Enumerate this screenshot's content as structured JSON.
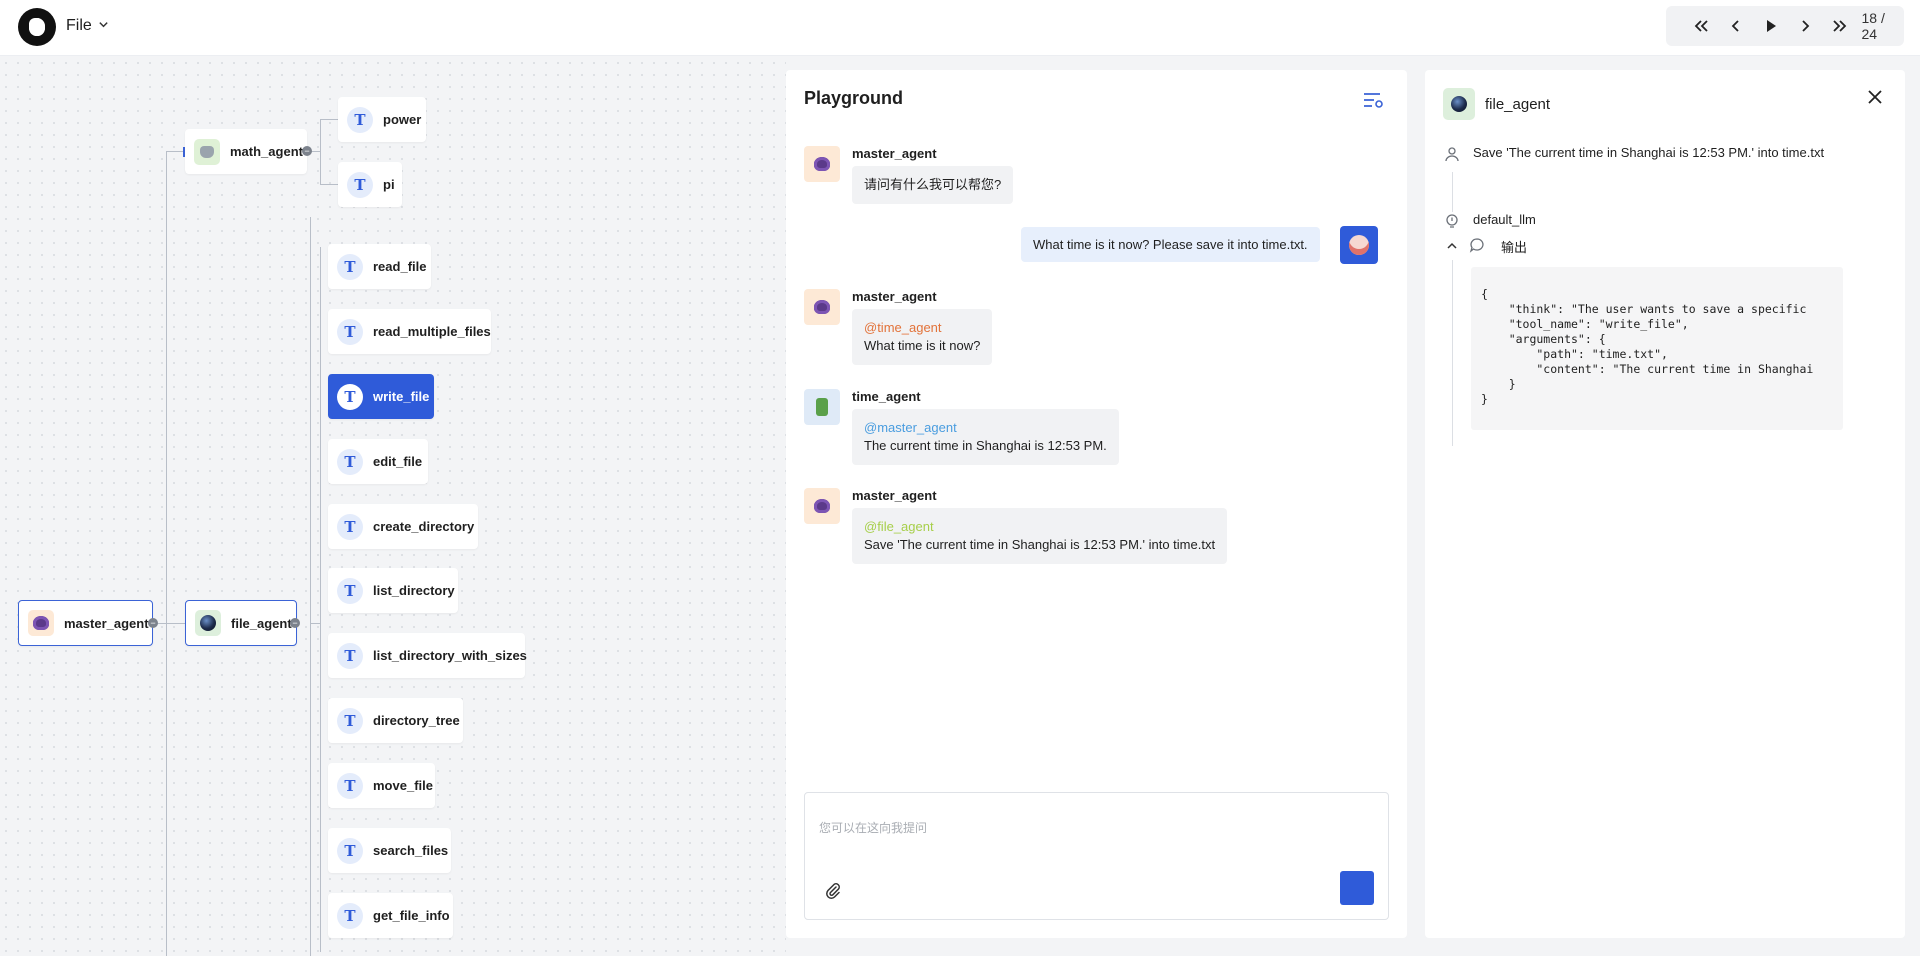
{
  "topbar": {
    "file_menu_label": "File",
    "player": {
      "current": "18",
      "total": "24",
      "counter_text": "18 / 24"
    }
  },
  "tree": {
    "root": {
      "label": "master_agent"
    },
    "agents": [
      {
        "label": "math_agent",
        "tools": [
          "power",
          "pi"
        ]
      },
      {
        "label": "file_agent",
        "tools": [
          "read_file",
          "read_multiple_files",
          "write_file",
          "edit_file",
          "create_directory",
          "list_directory",
          "list_directory_with_sizes",
          "directory_tree",
          "move_file",
          "search_files",
          "get_file_info"
        ]
      }
    ],
    "active_tool": "write_file",
    "collapse_symbol": "−"
  },
  "playground": {
    "title": "Playground",
    "messages": [
      {
        "sender": "master_agent",
        "mention": "",
        "text": "请问有什么我可以帮您?"
      },
      {
        "sender": "user",
        "text": "What time is it now? Please save it into time.txt."
      },
      {
        "sender": "master_agent",
        "mention": "@time_agent",
        "text": "What time is it now?"
      },
      {
        "sender": "time_agent",
        "mention": "@master_agent",
        "text": "The current time in Shanghai is 12:53 PM."
      },
      {
        "sender": "master_agent",
        "mention": "@file_agent",
        "text": "Save 'The current time in Shanghai is 12:53 PM.' into time.txt"
      }
    ],
    "input_placeholder": "您可以在这向我提问"
  },
  "detail": {
    "title": "file_agent",
    "input_text": "Save 'The current time in Shanghai is 12:53 PM.' into time.txt",
    "llm_label": "default_llm",
    "output_label": "输出",
    "output_code": "{\n    \"think\": \"The user wants to save a specific\n    \"tool_name\": \"write_file\",\n    \"arguments\": {\n        \"path\": \"time.txt\",\n        \"content\": \"The current time in Shanghai\n    }\n}"
  },
  "colors": {
    "accent": "#2f5bd9",
    "mention_time_agent": "#e2733a",
    "mention_master_agent": "#4a9ddf",
    "mention_file_agent": "#a7cf4a"
  },
  "icons": {
    "logo": "app-logo",
    "tool": "tool-t-icon",
    "settings": "settings-list-icon",
    "attach": "paperclip-icon",
    "close": "close-icon",
    "user": "user-icon",
    "llm": "lightbulb-icon",
    "output": "chat-bubble-icon"
  }
}
